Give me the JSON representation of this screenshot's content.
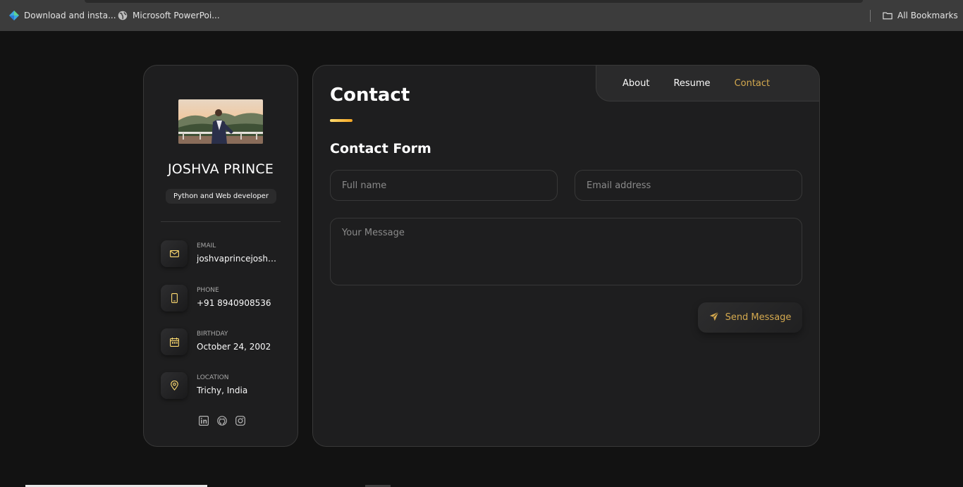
{
  "bookmarks": {
    "items": [
      {
        "label": "Download and insta...",
        "icon": "sparkle-icon"
      },
      {
        "label": "Microsoft PowerPoi...",
        "icon": "globe-icon"
      }
    ],
    "all_label": "All Bookmarks"
  },
  "profile": {
    "name": "JOSHVA PRINCE",
    "title": "Python and Web developer",
    "contacts": [
      {
        "label": "EMAIL",
        "value": "joshvaprincejoshva...",
        "icon": "mail-icon"
      },
      {
        "label": "PHONE",
        "value": "+91 8940908536",
        "icon": "phone-icon"
      },
      {
        "label": "BIRTHDAY",
        "value": "October 24, 2002",
        "icon": "calendar-icon"
      },
      {
        "label": "LOCATION",
        "value": "Trichy, India",
        "icon": "location-pin-icon"
      }
    ],
    "socials": [
      "linkedin-icon",
      "github-icon",
      "instagram-icon"
    ]
  },
  "nav": {
    "about": "About",
    "resume": "Resume",
    "contact": "Contact",
    "active": "contact"
  },
  "contact": {
    "page_title": "Contact",
    "form_title": "Contact Form",
    "fullname_placeholder": "Full name",
    "email_placeholder": "Email address",
    "message_placeholder": "Your Message",
    "send_label": "Send Message"
  },
  "colors": {
    "background": "#121212",
    "card": "#1e1e1f",
    "accent": "#d4a94f",
    "underline": "#ffdb70"
  }
}
